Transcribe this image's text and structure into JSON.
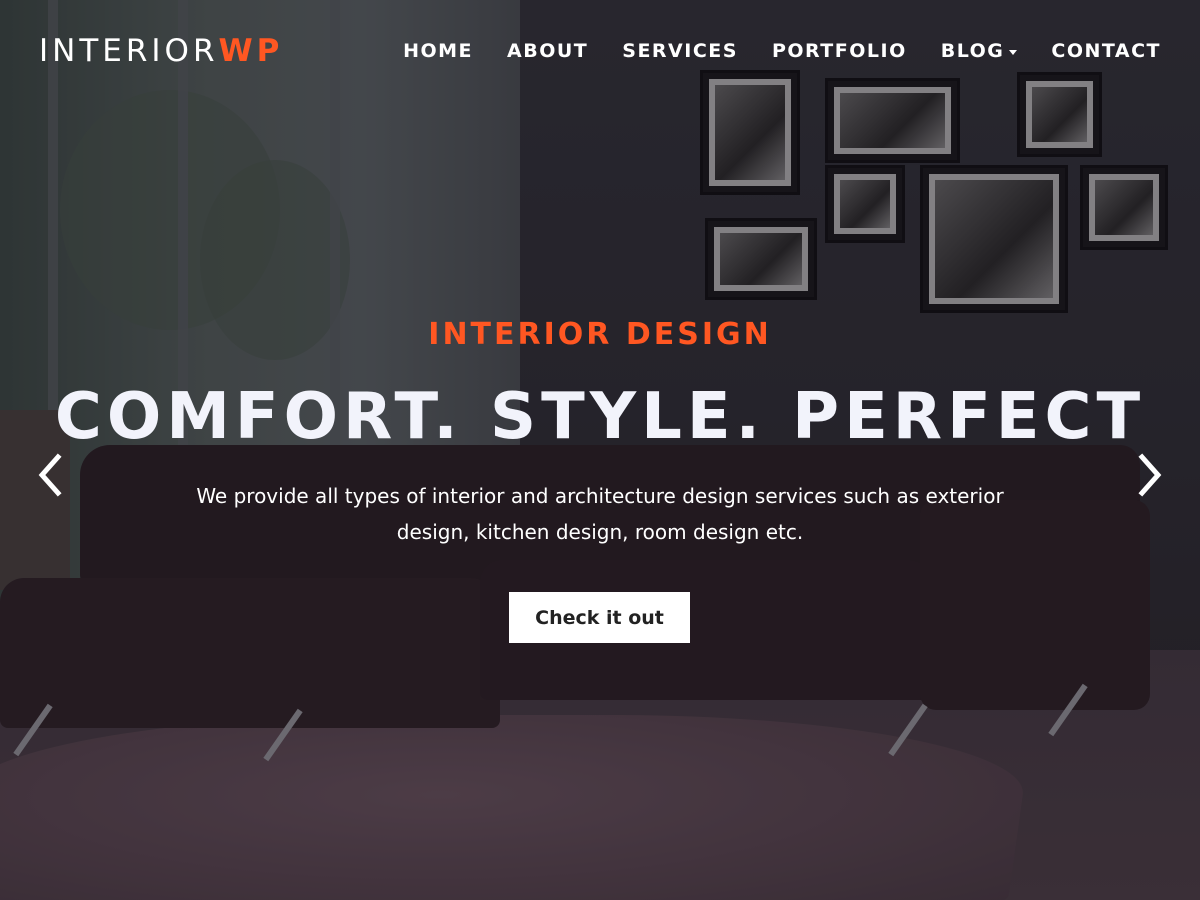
{
  "logo": {
    "part1": "INTERIOR",
    "part2": "WP"
  },
  "nav": {
    "items": [
      {
        "label": "HOME"
      },
      {
        "label": "ABOUT"
      },
      {
        "label": "SERVICES"
      },
      {
        "label": "PORTFOLIO"
      },
      {
        "label": "BLOG",
        "has_dropdown": true
      },
      {
        "label": "CONTACT"
      }
    ]
  },
  "hero": {
    "eyebrow": "INTERIOR DESIGN",
    "headline": "COMFORT. STYLE. PERFECT",
    "subtext": "We provide all types of interior and architecture design services such as exterior design, kitchen design, room design etc.",
    "cta_label": "Check it out"
  },
  "slider": {
    "prev_icon": "chevron-left-icon",
    "next_icon": "chevron-right-icon"
  },
  "colors": {
    "accent": "#ff5722",
    "text": "#ffffff",
    "button_bg": "#ffffff",
    "button_text": "#222222"
  }
}
